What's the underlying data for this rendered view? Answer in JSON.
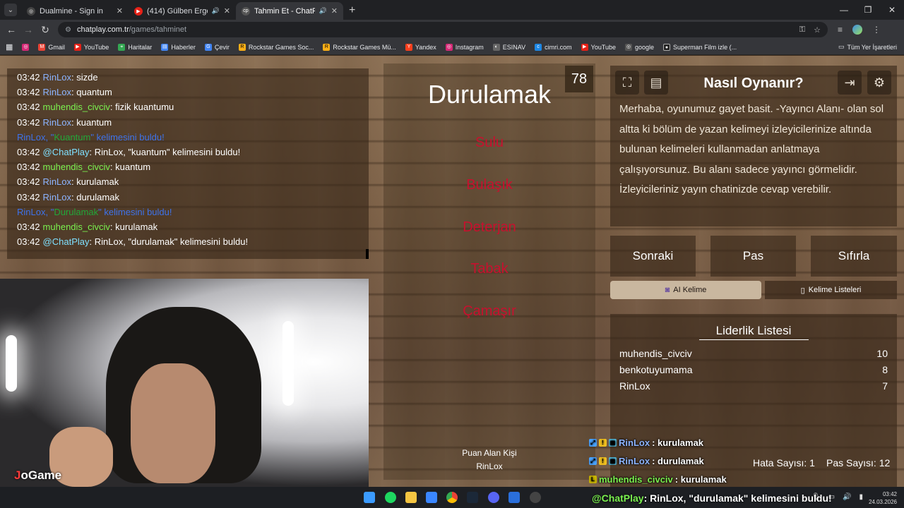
{
  "browser": {
    "tabs": [
      {
        "title": "Dualmine - Sign in",
        "active": false,
        "audio": false
      },
      {
        "title": "(414) Gülben Ergen - Yarı Çı",
        "active": false,
        "audio": true
      },
      {
        "title": "Tahmin Et - ChatPlay",
        "active": true,
        "audio": true
      }
    ],
    "new_tab": "+",
    "url_host": "chatplay.com.tr",
    "url_path": "/games/tahminet",
    "bookmarks": [
      "Gmail",
      "YouTube",
      "Haritalar",
      "Haberler",
      "Çevir",
      "Rockstar Games Soc...",
      "Rockstar Games Mü...",
      "Yandex",
      "Instagram",
      "ESINAV",
      "cimri.com",
      "YouTube",
      "google",
      "Superman Film izle (..."
    ],
    "bookmarks_right": "Tüm Yer İşaretleri"
  },
  "chat": {
    "messages": [
      {
        "time": "03:42",
        "user": "RinLox",
        "text": "sizde",
        "color": "blue"
      },
      {
        "time": "03:42",
        "user": "RinLox",
        "text": "quantum",
        "color": "blue"
      },
      {
        "time": "03:42",
        "user": "muhendis_civciv",
        "text": "fizik kuantumu",
        "color": "green"
      },
      {
        "time": "03:42",
        "user": "RinLox",
        "text": "kuantum",
        "color": "blue"
      },
      {
        "system": true,
        "pre": "RinLox, \"",
        "word": "Kuantum",
        "post": "\" kelimesini buldu!"
      },
      {
        "time": "03:42",
        "user": "@ChatPlay",
        "text": "RinLox, \"kuantum\" kelimesini buldu!",
        "color": "cyan"
      },
      {
        "time": "03:42",
        "user": "muhendis_civciv",
        "text": "kuantum",
        "color": "green"
      },
      {
        "time": "03:42",
        "user": "RinLox",
        "text": "kurulamak",
        "color": "blue"
      },
      {
        "time": "03:42",
        "user": "RinLox",
        "text": "durulamak",
        "color": "blue"
      },
      {
        "system": true,
        "pre": "RinLox, \"",
        "word": "Durulamak",
        "post": "\" kelimesini buldu!"
      },
      {
        "time": "03:42",
        "user": "muhendis_civciv",
        "text": "kurulamak",
        "color": "green"
      },
      {
        "time": "03:42",
        "user": "@ChatPlay",
        "text": "RinLox, \"durulamak\" kelimesini buldu!",
        "color": "cyan"
      }
    ]
  },
  "webcam": {
    "logo_prefix": "J",
    "logo_text": "oGame"
  },
  "game": {
    "counter": "78",
    "word": "Durulamak",
    "forbidden": [
      "Sulu",
      "Bulaşık",
      "Deterjan",
      "Tabak",
      "Çamaşır"
    ],
    "scorer_label": "Puan Alan Kişi",
    "scorer": "RinLox"
  },
  "howto": {
    "title": "Nasıl Oynanır?",
    "text": "Merhaba, oyunumuz gayet basit. -Yayıncı Alanı- olan sol altta ki bölüm de yazan kelimeyi izleyicilerinize altında bulunan kelimeleri kullanmadan anlatmaya çalışıyorsunuz. Bu alanı sadece yayıncı görmelidir. İzleyicileriniz yayın chatinizde cevap verebilir."
  },
  "controls": {
    "next": "Sonraki",
    "pass": "Pas",
    "reset": "Sıfırla",
    "ai_word": "AI Kelime",
    "word_lists": "Kelime Listeleri"
  },
  "leaderboard": {
    "title": "Liderlik Listesi",
    "rows": [
      {
        "name": "muhendis_civciv",
        "score": "10"
      },
      {
        "name": "benkotuyumama",
        "score": "8"
      },
      {
        "name": "RinLox",
        "score": "7"
      }
    ]
  },
  "stats": {
    "errors": "Hata Sayısı: 1",
    "passes": "Pas Sayısı: 12"
  },
  "overlay_chat": [
    {
      "user": "RinLox",
      "text": ": kurulamak"
    },
    {
      "user": "RinLox",
      "text": ": durulamak"
    },
    {
      "user": "muhendis_civciv",
      "text": ": kurulamak"
    },
    {
      "user": "@ChatPlay",
      "text": ": RinLox, \"durulamak\" kelimesini buldu!"
    }
  ],
  "taskbar": {
    "time": "03:42",
    "date": "24.03.2026"
  },
  "colors": {
    "forbidden": "#c8102e",
    "chat_blue": "#8cb4ff",
    "chat_green": "#7bf24f",
    "system_blue": "#3c78ff"
  }
}
